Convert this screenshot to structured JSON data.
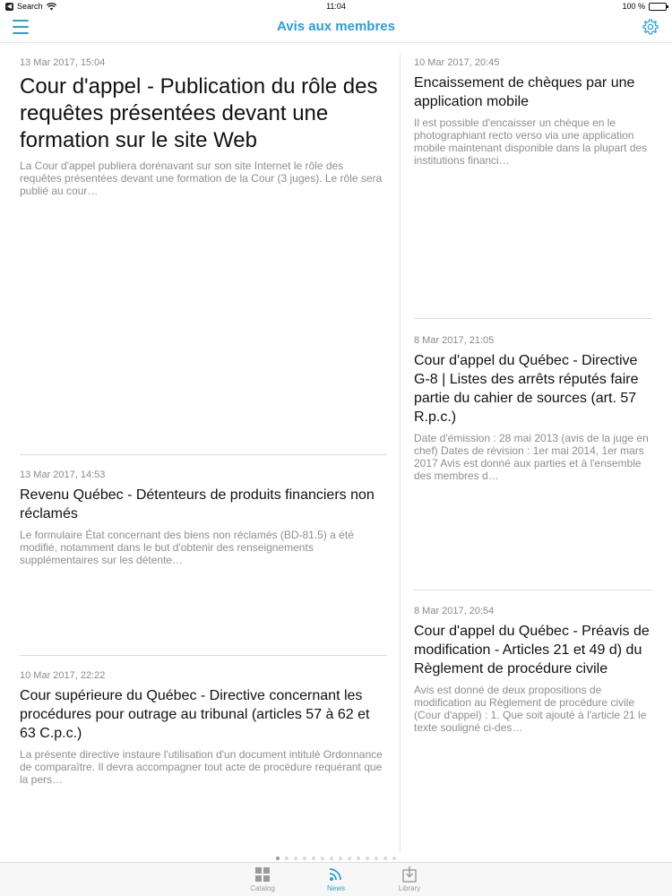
{
  "status_bar": {
    "carrier": "Search",
    "time": "11:04",
    "battery_text": "100 %",
    "battery_level": 1.0
  },
  "nav": {
    "title": "Avis aux membres",
    "menu_icon": "hamburger-icon",
    "settings_icon": "gear-icon"
  },
  "colors": {
    "accent": "#2a9fd6",
    "muted_text": "#8e8e8e",
    "divider": "#dcdcdc"
  },
  "articles": [
    {
      "date": "13 Mar 2017, 15:04",
      "title": "Cour d'appel - Publication du rôle des requêtes présentées devant une formation sur le site Web",
      "excerpt": "La Cour d'appel publiera dorénavant sur son site Internet le rôle des requêtes présentées devant une formation de la Cour (3 juges). Le rôle sera publié au cour…"
    },
    {
      "date": "13 Mar 2017, 14:53",
      "title": "Revenu Québec - Détenteurs de produits financiers non réclamés",
      "excerpt": "Le formulaire État concernant des biens non réclamés (BD-81.5) a été modifié, notamment dans le but d'obtenir des renseignements supplémentaires sur les détente…"
    },
    {
      "date": "10 Mar 2017, 22:22",
      "title": "Cour supérieure du Québec - Directive concernant les procédures pour outrage au tribunal (articles 57 à 62 et 63 C.p.c.)",
      "excerpt": "La présente directive instaure l'utilisation d'un document intitulé Ordonnance de comparaître. Il devra accompagner tout acte de procédure requérant que la pers…"
    },
    {
      "date": "10 Mar 2017, 20:45",
      "title": "Encaissement de chèques par une application mobile",
      "excerpt": "Il est possible d'encaisser un chèque en le photographiant recto verso via une application mobile maintenant disponible dans la plupart des institutions financi…"
    },
    {
      "date": "8 Mar 2017, 21:05",
      "title": "Cour d'appel du Québec - Directive G-8 | Listes des arrêts réputés faire partie du cahier de sources (art. 57 R.p.c.)",
      "excerpt": "Date d'émission : 28 mai 2013 (avis de la juge en chef) Dates de révision : 1er mai 2014, 1er mars 2017 Avis est donné aux parties et à l'ensemble des membres d…"
    },
    {
      "date": "8 Mar 2017, 20:54",
      "title": "Cour d'appel du Québec - Préavis de modification - Articles 21 et 49 d) du Règlement de procédure civile",
      "excerpt": "Avis est donné de deux propositions de modification au Règlement de procédure civile (Cour d'appel) : 1. Que soit ajouté à l'article 21 le texte souligné ci-des…"
    }
  ],
  "pager": {
    "total_pages": 14,
    "current_page": 1
  },
  "tabs": [
    {
      "label": "Catalog",
      "icon": "catalog-grid-icon",
      "active": false
    },
    {
      "label": "News",
      "icon": "news-feed-icon",
      "active": true
    },
    {
      "label": "Library",
      "icon": "library-download-icon",
      "active": false
    }
  ]
}
